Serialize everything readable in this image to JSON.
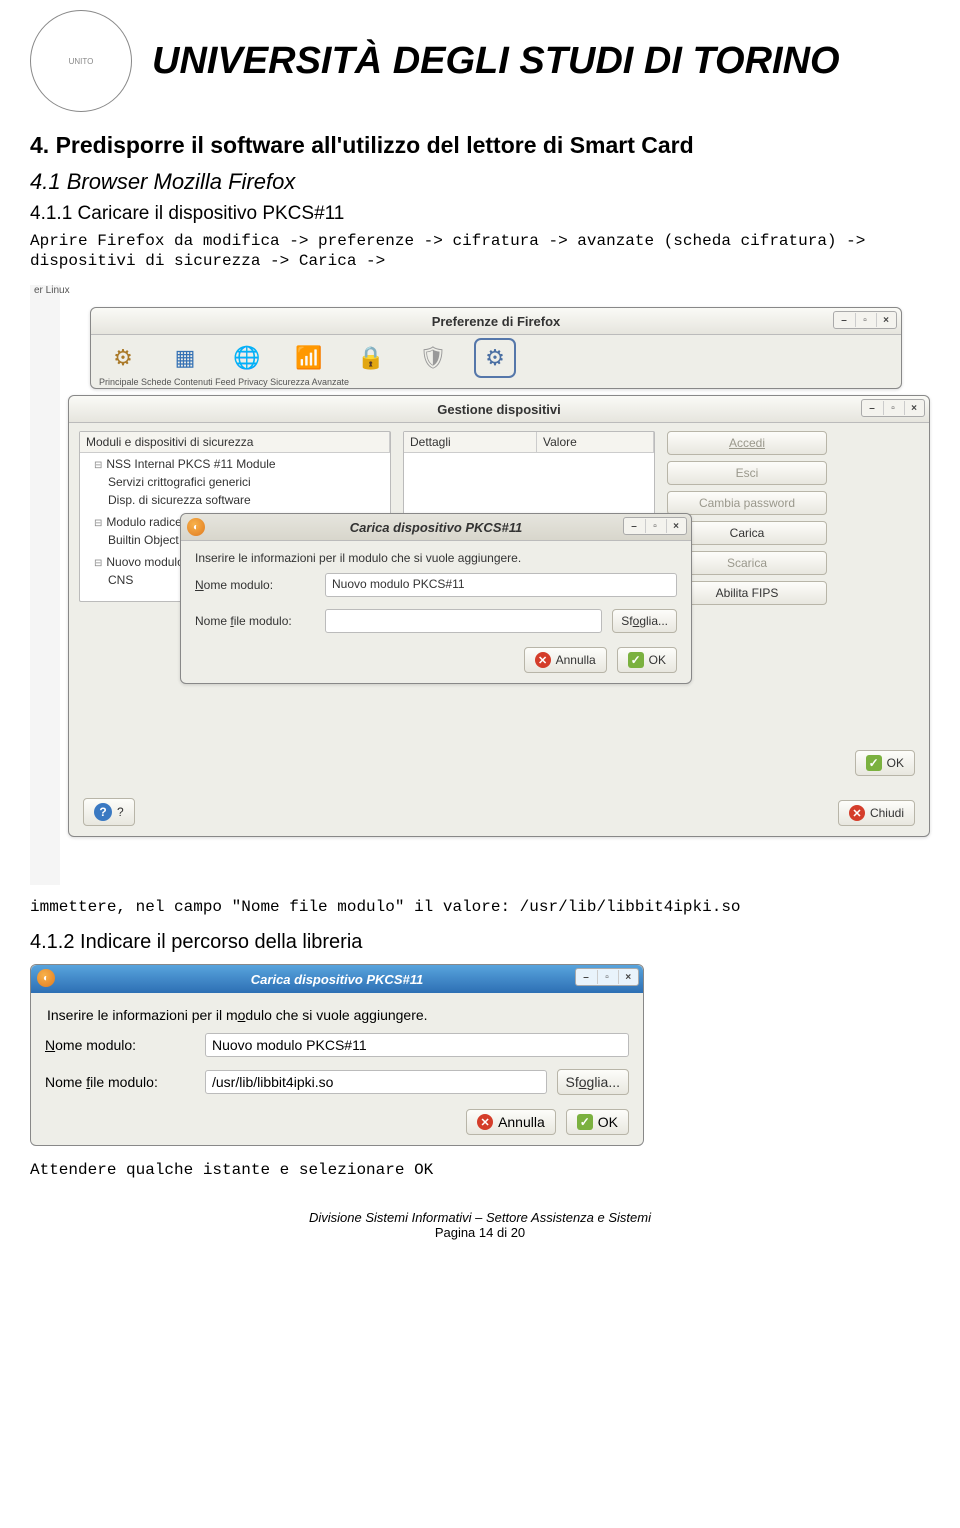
{
  "header": {
    "title": "UNIVERSITÀ DEGLI STUDI DI TORINO"
  },
  "section": {
    "num_title": "4. Predisporre il software all'utilizzo del lettore di Smart Card",
    "sub1": "4.1 Browser Mozilla Firefox",
    "sub11": "4.1.1 Caricare il dispositivo PKCS#11",
    "instr1": "Aprire Firefox da modifica -> preferenze -> cifratura -> avanzate (scheda cifratura) -> dispositivi di sicurezza -> Carica ->",
    "instr2": "immettere, nel campo \"Nome file modulo\" il valore: /usr/lib/libbit4ipki.so",
    "sub12": "4.1.2 Indicare il percorso della libreria",
    "instr3": "Attendere qualche istante e selezionare OK"
  },
  "screenshot1": {
    "bg_tab": "er Linux",
    "prefs_title": "Preferenze di Firefox",
    "toolbar_labels": "Principale   Schede   Contenuti   Feed   Privacy   Sicurezza   Avanzate",
    "devices_title": "Gestione dispositivi",
    "tree_header": "Moduli e dispositivi di sicurezza",
    "det_col": "Dettagli",
    "val_col": "Valore",
    "tree": {
      "nss": "NSS Internal PKCS #11 Module",
      "servizi": "Servizi crittografici generici",
      "disp": "Disp. di sicurezza software",
      "modroot": "Modulo radice predefinito",
      "builtin": "Builtin Object",
      "nuovo": "Nuovo modulo",
      "cns": "CNS"
    },
    "btns": {
      "accedi": "Accedi",
      "esci": "Esci",
      "cambia": "Cambia password",
      "carica": "Carica",
      "scarica": "Scarica",
      "fips": "Abilita FIPS"
    },
    "pkcs_title": "Carica dispositivo PKCS#11",
    "pkcs_msg": "Inserire le informazioni per il modulo che si vuole aggiungere.",
    "pkcs_name_label": "Nome modulo:",
    "pkcs_name_value": "Nuovo modulo PKCS#11",
    "pkcs_file_label": "Nome file modulo:",
    "pkcs_browse": "Sfoglia...",
    "annulla": "Annulla",
    "ok": "OK",
    "chiudi": "Chiudi",
    "help": "?"
  },
  "screenshot2": {
    "title": "Carica dispositivo PKCS#11",
    "msg": "Inserire le informazioni per il modulo che si vuole aggiungere.",
    "name_label": "Nome modulo:",
    "name_value": "Nuovo modulo PKCS#11",
    "file_label": "Nome file modulo:",
    "file_value": "/usr/lib/libbit4ipki.so",
    "browse": "Sfoglia...",
    "annulla": "Annulla",
    "ok": "OK"
  },
  "footer": {
    "line1": "Divisione Sistemi Informativi – Settore Assistenza e Sistemi",
    "line2": "Pagina 14 di 20"
  }
}
